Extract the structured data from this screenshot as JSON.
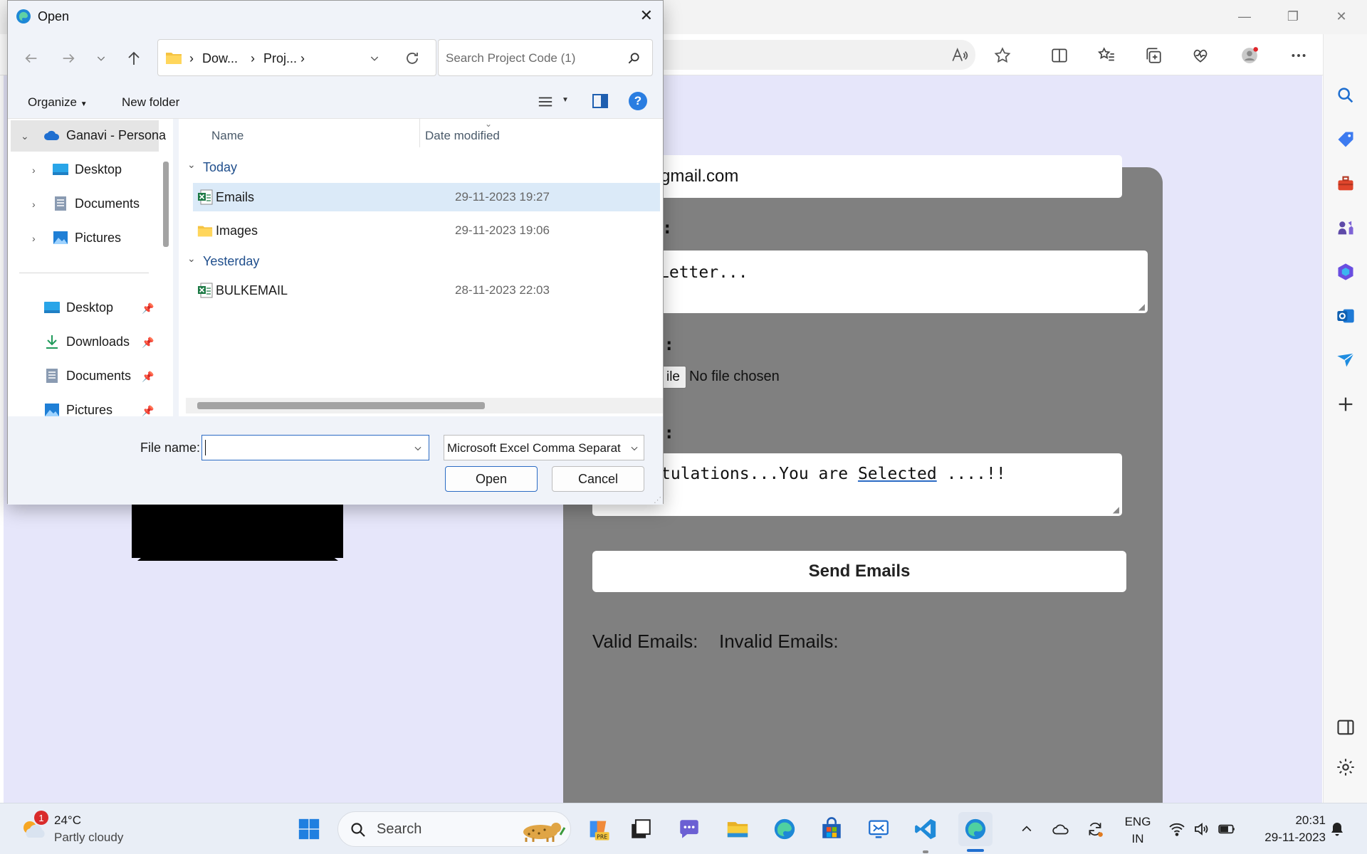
{
  "dialog": {
    "title": "Open",
    "close_glyph": "✕",
    "breadcrumb": [
      "Dow...",
      "Proj..."
    ],
    "search_placeholder": "Search Project Code (1)",
    "organize_label": "Organize",
    "new_folder_label": "New folder",
    "help_glyph": "?",
    "nav_pane": {
      "root": "Ganavi - Persona",
      "root_children": [
        {
          "label": "Desktop",
          "icon": "desktop-icon"
        },
        {
          "label": "Documents",
          "icon": "documents-icon"
        },
        {
          "label": "Pictures",
          "icon": "pictures-icon"
        }
      ],
      "quick_access": [
        {
          "label": "Desktop",
          "icon": "desktop-icon"
        },
        {
          "label": "Downloads",
          "icon": "downloads-icon"
        },
        {
          "label": "Documents",
          "icon": "documents-icon"
        },
        {
          "label": "Pictures",
          "icon": "pictures-icon"
        }
      ]
    },
    "columns": {
      "name": "Name",
      "date_modified": "Date modified"
    },
    "groups": [
      {
        "label": "Today",
        "files": [
          {
            "name": "Emails",
            "date": "29-11-2023 19:27",
            "icon": "excel-csv-icon",
            "selected": true
          },
          {
            "name": "Images",
            "date": "29-11-2023 19:06",
            "icon": "folder-icon",
            "selected": false
          }
        ]
      },
      {
        "label": "Yesterday",
        "files": [
          {
            "name": "BULKEMAIL",
            "date": "28-11-2023 22:03",
            "icon": "excel-csv-icon",
            "selected": false
          }
        ]
      }
    ],
    "file_name_label": "File name:",
    "file_name_value": "",
    "file_type": "Microsoft Excel Comma Separat",
    "open_label": "Open",
    "cancel_label": "Cancel"
  },
  "page": {
    "email_fragment": "gmail.com",
    "label1_fragment": ":",
    "subject_fragment": "Letter...",
    "label2_fragment": "e:",
    "file_button_fragment": "ile",
    "no_file": "No file chosen",
    "label3_fragment": "e:",
    "message_fragment_pre": "tulations...You are ",
    "message_fragment_word": "Selected",
    "message_fragment_post": " ....!!",
    "send_button": "Send Emails",
    "valid_label": "Valid Emails:",
    "invalid_label": "Invalid Emails:"
  },
  "taskbar": {
    "temperature": "24°C",
    "weather": "Partly cloudy",
    "weather_badge": "1",
    "search_label": "Search",
    "language_line1": "ENG",
    "language_line2": "IN",
    "time": "20:31",
    "date": "29-11-2023"
  },
  "colors": {
    "page_bg": "#e6e6fa",
    "card_bg": "#808080",
    "dialog_accent": "#2b6bc4",
    "selection": "#dbeaf8"
  }
}
